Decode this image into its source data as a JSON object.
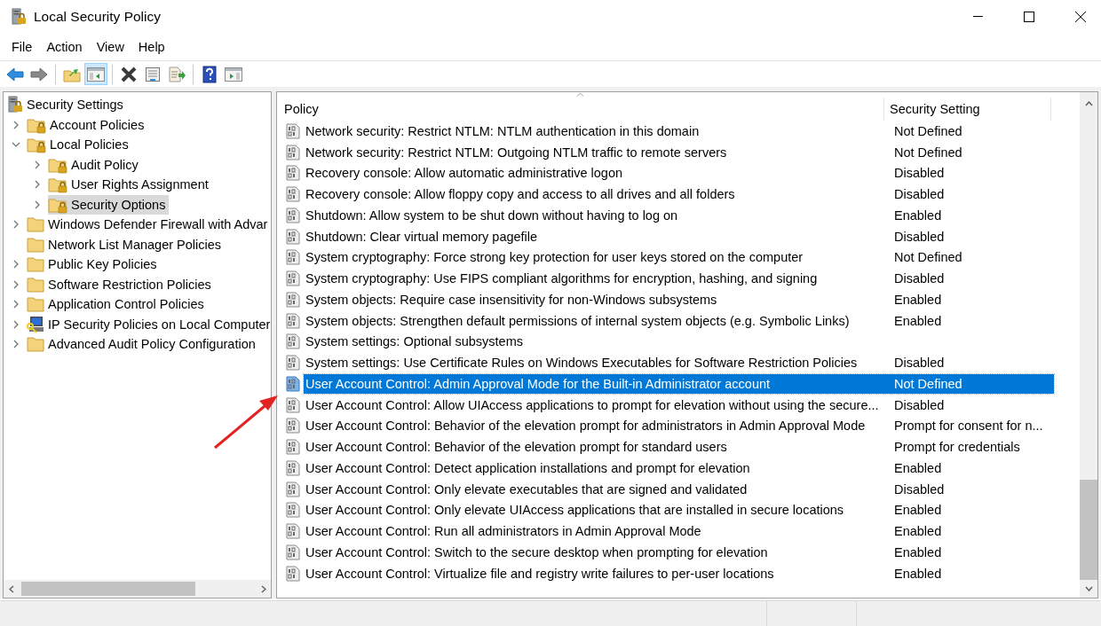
{
  "window": {
    "title": "Local Security Policy"
  },
  "menu": [
    "File",
    "Action",
    "View",
    "Help"
  ],
  "toolbar": [
    {
      "kind": "back",
      "pressed": false
    },
    {
      "kind": "forward",
      "pressed": false
    },
    {
      "kind": "up",
      "pressed": false
    },
    {
      "kind": "tree-toggle",
      "pressed": true
    },
    {
      "kind": "delete",
      "pressed": false
    },
    {
      "kind": "properties",
      "pressed": false
    },
    {
      "kind": "export",
      "pressed": false
    },
    {
      "kind": "help",
      "pressed": false
    },
    {
      "kind": "action-pane",
      "pressed": false
    }
  ],
  "tree": {
    "root": {
      "label": "Security Settings",
      "kind": "server"
    },
    "items": [
      {
        "label": "Account Policies",
        "kind": "lock-folder",
        "expanded": false,
        "selected": false
      },
      {
        "label": "Local Policies",
        "kind": "lock-folder",
        "expanded": true,
        "selected": false,
        "children": [
          {
            "label": "Audit Policy",
            "kind": "lock-folder",
            "expanded": false,
            "selected": false
          },
          {
            "label": "User Rights Assignment",
            "kind": "lock-folder",
            "expanded": false,
            "selected": false
          },
          {
            "label": "Security Options",
            "kind": "lock-folder",
            "expanded": false,
            "selected": true
          }
        ]
      },
      {
        "label": "Windows Defender Firewall with Advar",
        "kind": "folder",
        "expanded": false,
        "selected": false
      },
      {
        "label": "Network List Manager Policies",
        "kind": "folder",
        "selected": false
      },
      {
        "label": "Public Key Policies",
        "kind": "folder",
        "expanded": false,
        "selected": false
      },
      {
        "label": "Software Restriction Policies",
        "kind": "folder",
        "expanded": false,
        "selected": false
      },
      {
        "label": "Application Control Policies",
        "kind": "folder",
        "expanded": false,
        "selected": false
      },
      {
        "label": "IP Security Policies on Local Computer",
        "kind": "computer",
        "expanded": false,
        "selected": false
      },
      {
        "label": "Advanced Audit Policy Configuration",
        "kind": "folder",
        "expanded": false,
        "selected": false
      }
    ]
  },
  "policies": {
    "columns": [
      "Policy",
      "Security Setting"
    ],
    "rows": [
      {
        "policy": "Network security: Restrict NTLM: NTLM authentication in this domain",
        "setting": "Not Defined",
        "selected": false
      },
      {
        "policy": "Network security: Restrict NTLM: Outgoing NTLM traffic to remote servers",
        "setting": "Not Defined",
        "selected": false
      },
      {
        "policy": "Recovery console: Allow automatic administrative logon",
        "setting": "Disabled",
        "selected": false
      },
      {
        "policy": "Recovery console: Allow floppy copy and access to all drives and all folders",
        "setting": "Disabled",
        "selected": false
      },
      {
        "policy": "Shutdown: Allow system to be shut down without having to log on",
        "setting": "Enabled",
        "selected": false
      },
      {
        "policy": "Shutdown: Clear virtual memory pagefile",
        "setting": "Disabled",
        "selected": false
      },
      {
        "policy": "System cryptography: Force strong key protection for user keys stored on the computer",
        "setting": "Not Defined",
        "selected": false
      },
      {
        "policy": "System cryptography: Use FIPS compliant algorithms for encryption, hashing, and signing",
        "setting": "Disabled",
        "selected": false
      },
      {
        "policy": "System objects: Require case insensitivity for non-Windows subsystems",
        "setting": "Enabled",
        "selected": false
      },
      {
        "policy": "System objects: Strengthen default permissions of internal system objects (e.g. Symbolic Links)",
        "setting": "Enabled",
        "selected": false
      },
      {
        "policy": "System settings: Optional subsystems",
        "selected": false
      },
      {
        "policy": "System settings: Use Certificate Rules on Windows Executables for Software Restriction Policies",
        "setting": "Disabled",
        "selected": false
      },
      {
        "policy": "User Account Control: Admin Approval Mode for the Built-in Administrator account",
        "setting": "Not Defined",
        "selected": true
      },
      {
        "policy": "User Account Control: Allow UIAccess applications to prompt for elevation without using the secure...",
        "setting": "Disabled",
        "selected": false
      },
      {
        "policy": "User Account Control: Behavior of the elevation prompt for administrators in Admin Approval Mode",
        "setting": "Prompt for consent for n...",
        "selected": false
      },
      {
        "policy": "User Account Control: Behavior of the elevation prompt for standard users",
        "setting": "Prompt for credentials",
        "selected": false
      },
      {
        "policy": "User Account Control: Detect application installations and prompt for elevation",
        "setting": "Enabled",
        "selected": false
      },
      {
        "policy": "User Account Control: Only elevate executables that are signed and validated",
        "setting": "Disabled",
        "selected": false
      },
      {
        "policy": "User Account Control: Only elevate UIAccess applications that are installed in secure locations",
        "setting": "Enabled",
        "selected": false
      },
      {
        "policy": "User Account Control: Run all administrators in Admin Approval Mode",
        "setting": "Enabled",
        "selected": false
      },
      {
        "policy": "User Account Control: Switch to the secure desktop when prompting for elevation",
        "setting": "Enabled",
        "selected": false
      },
      {
        "policy": "User Account Control: Virtualize file and registry write failures to per-user locations",
        "setting": "Enabled",
        "selected": false
      }
    ]
  }
}
